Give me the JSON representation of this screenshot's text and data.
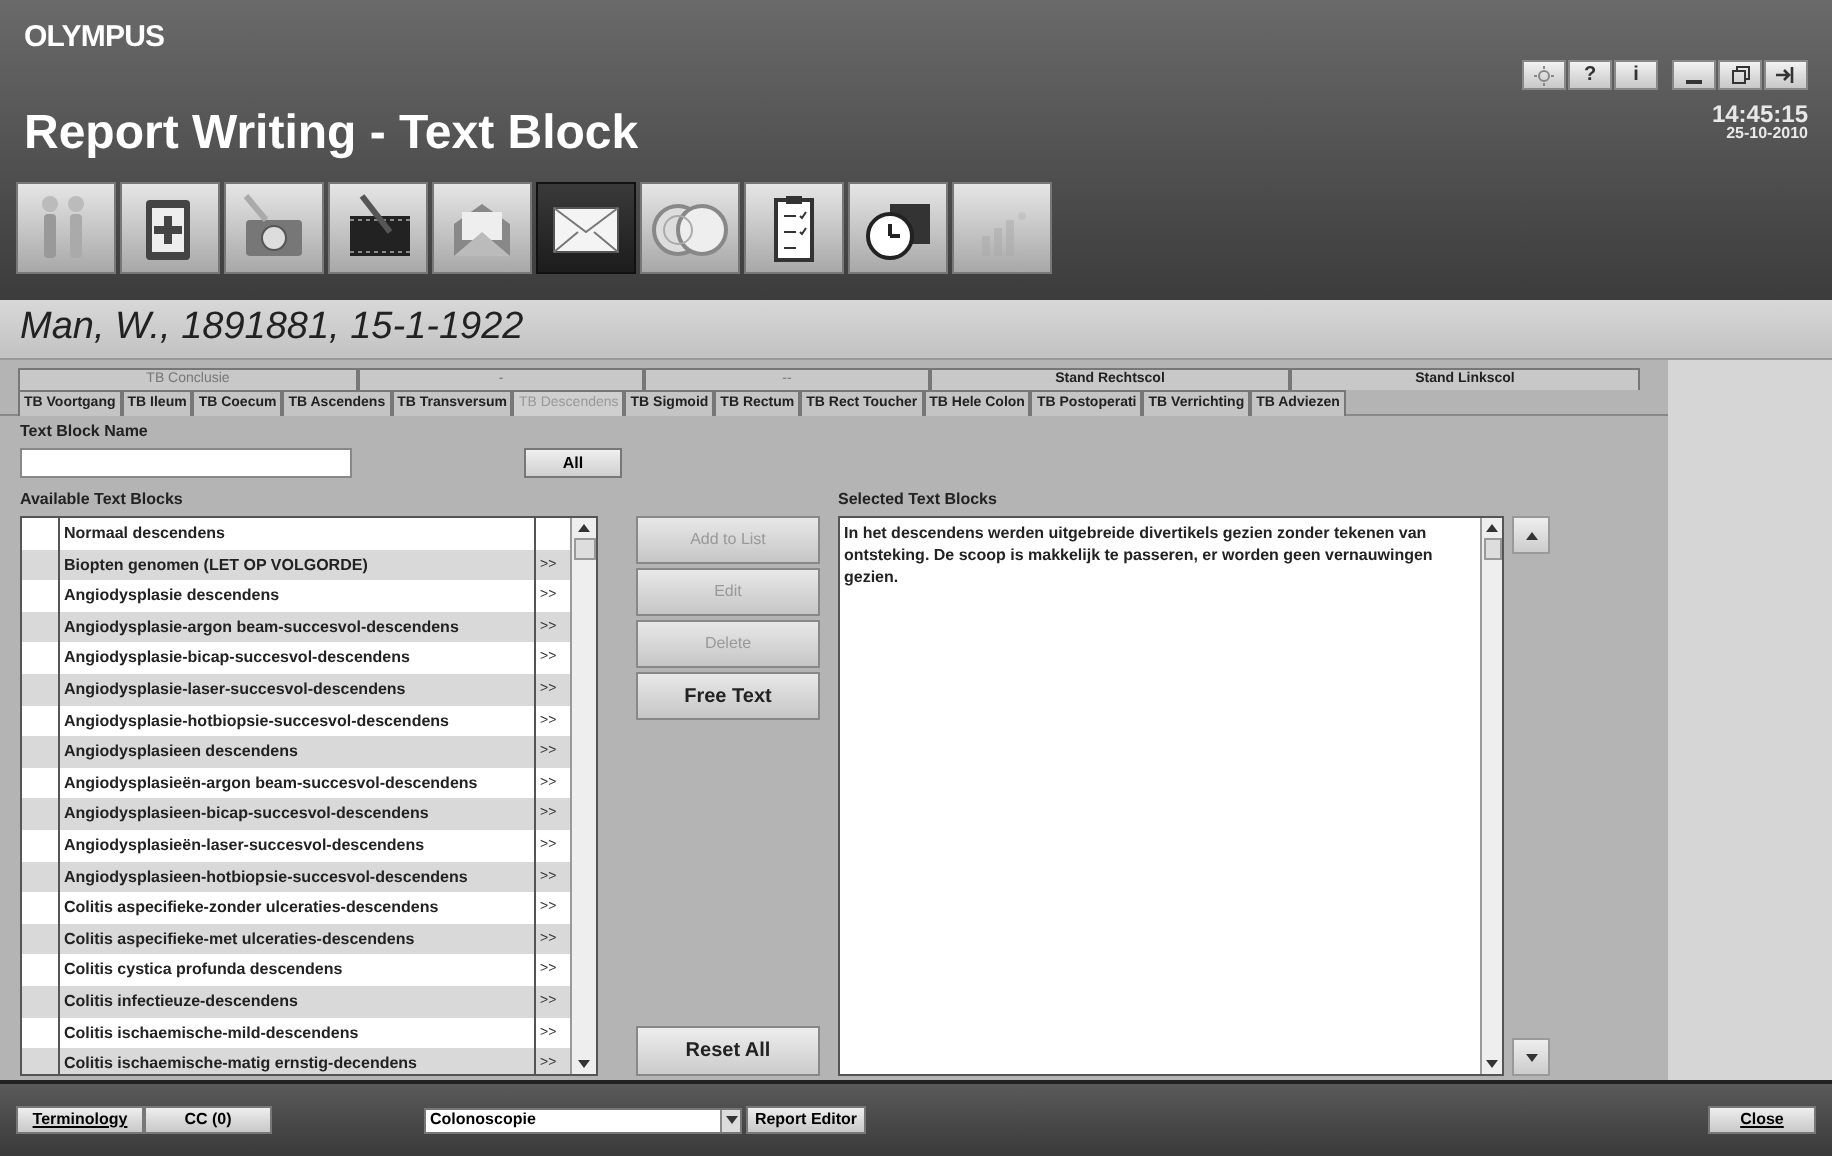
{
  "header": {
    "logo": "OLYMPUS",
    "title": "Report Writing - Text Block",
    "time": "14:45:15",
    "date": "25-10-2010",
    "window_buttons": [
      {
        "kind": "settings"
      },
      {
        "kind": "text",
        "label": "?"
      },
      {
        "kind": "text",
        "label": "i"
      },
      {
        "kind": "minimize"
      },
      {
        "kind": "restore"
      },
      {
        "kind": "exit"
      }
    ]
  },
  "toolbar": [
    {
      "kind": "people",
      "selected": false,
      "disabled": false
    },
    {
      "kind": "medical",
      "selected": false,
      "disabled": false
    },
    {
      "kind": "camera",
      "selected": false,
      "disabled": false
    },
    {
      "kind": "film",
      "selected": false,
      "disabled": false
    },
    {
      "kind": "open-mail",
      "selected": false,
      "disabled": false
    },
    {
      "kind": "mail",
      "selected": true,
      "disabled": false
    },
    {
      "kind": "coins",
      "selected": false,
      "disabled": false
    },
    {
      "kind": "clipboard",
      "selected": false,
      "disabled": false
    },
    {
      "kind": "clock",
      "selected": false,
      "disabled": false
    },
    {
      "kind": "chart",
      "selected": false,
      "disabled": true
    }
  ],
  "patient": "Man, W., 1891881, 15-1-1922",
  "tabs_top": [
    {
      "label": "TB Conclusie",
      "disabled": true
    },
    {
      "label": "-",
      "disabled": true
    },
    {
      "label": "--",
      "disabled": true
    },
    {
      "label": "Stand Rechtscol",
      "disabled": false
    },
    {
      "label": "Stand Linkscol",
      "disabled": false
    }
  ],
  "tabs": [
    {
      "label": "TB Voortgang",
      "selected": false
    },
    {
      "label": "TB Ileum",
      "selected": false
    },
    {
      "label": "TB Coecum",
      "selected": false
    },
    {
      "label": "TB Ascendens",
      "selected": false
    },
    {
      "label": "TB Transversum",
      "selected": false
    },
    {
      "label": "TB Descendens",
      "selected": true
    },
    {
      "label": "TB Sigmoid",
      "selected": false
    },
    {
      "label": "TB Rectum",
      "selected": false
    },
    {
      "label": "TB Rect Toucher",
      "selected": false
    },
    {
      "label": "TB Hele Colon",
      "selected": false
    },
    {
      "label": "TB Postoperati",
      "selected": false
    },
    {
      "label": "TB Verrichting",
      "selected": false
    },
    {
      "label": "TB Adviezen",
      "selected": false
    }
  ],
  "name_label": "Text Block Name",
  "all_button": "All",
  "available_label": "Available Text Blocks",
  "available": [
    {
      "name": "Normaal descendens"
    },
    {
      "name": "Biopten genomen (LET OP VOLGORDE)",
      "more": ">>"
    },
    {
      "name": "Angiodysplasie descendens",
      "more": ">>"
    },
    {
      "name": "Angiodysplasie-argon beam-succesvol-descendens",
      "more": ">>"
    },
    {
      "name": "Angiodysplasie-bicap-succesvol-descendens",
      "more": ">>"
    },
    {
      "name": "Angiodysplasie-laser-succesvol-descendens",
      "more": ">>"
    },
    {
      "name": "Angiodysplasie-hotbiopsie-succesvol-descendens",
      "more": ">>"
    },
    {
      "name": "Angiodysplasieen descendens",
      "more": ">>"
    },
    {
      "name": "Angiodysplasieën-argon beam-succesvol-descendens",
      "more": ">>"
    },
    {
      "name": "Angiodysplasieen-bicap-succesvol-descendens",
      "more": ">>"
    },
    {
      "name": "Angiodysplasieën-laser-succesvol-descendens",
      "more": ">>"
    },
    {
      "name": "Angiodysplasieen-hotbiopsie-succesvol-descendens",
      "more": ">>"
    },
    {
      "name": "Colitis aspecifieke-zonder ulceraties-descendens",
      "more": ">>"
    },
    {
      "name": "Colitis aspecifieke-met ulceraties-descendens",
      "more": ">>"
    },
    {
      "name": "Colitis cystica profunda descendens",
      "more": ">>"
    },
    {
      "name": "Colitis infectieuze-descendens",
      "more": ">>"
    },
    {
      "name": "Colitis ischaemische-mild-descendens",
      "more": ">>"
    },
    {
      "name": "Colitis ischaemische-matig ernstig-decendens",
      "more": ">>"
    }
  ],
  "actions": [
    {
      "label": "Add to List",
      "disabled": true
    },
    {
      "label": "Edit",
      "disabled": true
    },
    {
      "label": "Delete",
      "disabled": true
    },
    {
      "label": "Free Text",
      "disabled": false
    }
  ],
  "reset_button": "Reset All",
  "selected_label": "Selected Text Blocks",
  "selected_text": "In het descendens werden uitgebreide divertikels gezien zonder tekenen van ontsteking. De scoop is makkelijk te passeren, er worden geen vernauwingen gezien.",
  "bottom": {
    "terminology": "Terminology",
    "cc": "CC (0)",
    "procedure": "Colonoscopie",
    "report_editor": "Report Editor",
    "close": "Close"
  }
}
